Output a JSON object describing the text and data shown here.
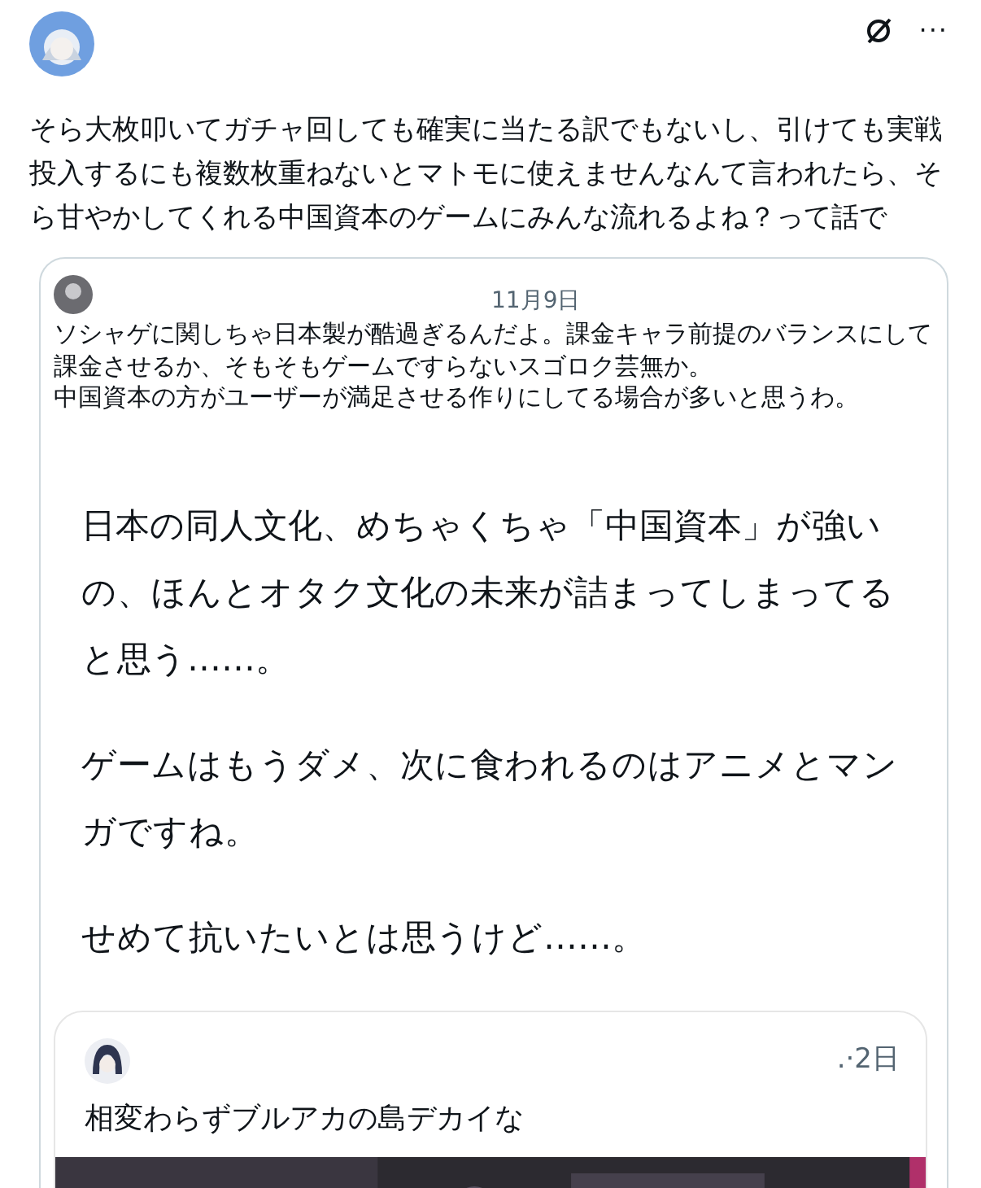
{
  "post": {
    "text": "そら大枚叩いてガチャ回しても確実に当たる訳でもないし、引けても実戦投入するにも複数枚重ねないとマトモに使えませんなんて言われたら、そら甘やかしてくれる中国資本のゲームにみんな流れるよね？って話で",
    "menu": "···"
  },
  "quote": {
    "date": "11月9日",
    "text_lines": [
      "ソシャゲに関しちゃ日本製が酷過ぎるんだよ。課金キャラ前提のバランスにして課金させるか、そもそもゲームですらないスゴロク芸無か。",
      "中国資本の方がユーザーが満足させる作りにしてる場合が多いと思うわ。"
    ],
    "screenshot": {
      "paragraphs": [
        "日本の同人文化、めちゃくちゃ「中国資本」が強いの、ほんとオタク文化の未来が詰まってしまってると思う……。",
        "ゲームはもうダメ、次に食われるのはアニメとマンガですね。",
        "せめて抗いたいとは思うけど……。"
      ],
      "inner_post": {
        "time": ".·2日",
        "text": "相変わらずブルアカの島デカイな"
      }
    }
  }
}
